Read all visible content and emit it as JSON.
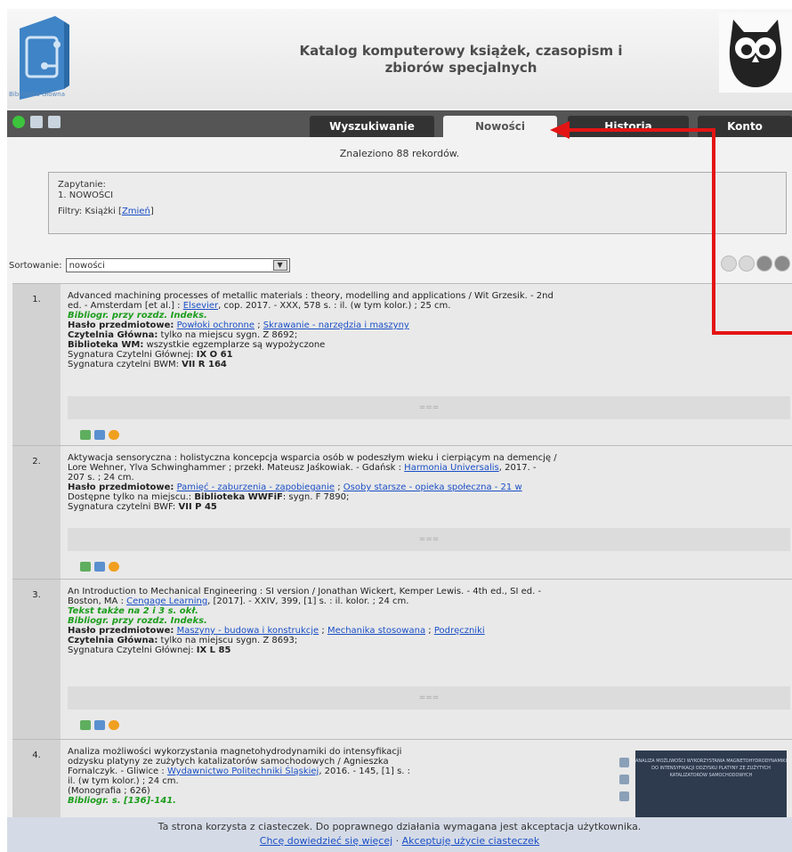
{
  "header": {
    "logo_text": "Biblioteka Główna",
    "title_line1": "Katalog komputerowy książek, czasopism i",
    "title_line2": "zbiorów specjalnych"
  },
  "tabs": [
    {
      "label": "Wyszukiwanie"
    },
    {
      "label": "Nowości"
    },
    {
      "label": "Historia"
    },
    {
      "label": "Konto"
    }
  ],
  "results": {
    "found": "Znaleziono 88 rekordów.",
    "query_label": "Zapytanie:",
    "query_value": "1. NOWOŚCI",
    "filters_label": "Filtry: Książki [",
    "filters_link": "Zmień",
    "filters_end": "]"
  },
  "sort": {
    "label": "Sortowanie:",
    "value": "nowości"
  },
  "more_label": "===",
  "records": [
    {
      "num": "1.",
      "line1": "Advanced machining processes of metallic materials : theory, modelling and applications / Wit Grzesik. - 2nd",
      "line2a": "ed. - Amsterdam [et al.] : ",
      "publisher": "Elsevier",
      "line2b": ", cop. 2017. - XXX, 578 s. : il. (w tym kolor.) ; 25 cm.",
      "note": "Bibliogr. przy rozdz. Indeks.",
      "subject_label": "Hasło przedmiotowe:",
      "subjects": [
        "Powłoki ochronne",
        "Skrawanie - narzędzia i maszyny"
      ],
      "loc1_label": "Czytelnia Główna:",
      "loc1": " tylko na miejscu sygn. Z 8692;",
      "loc2_label": "Biblioteka WM:",
      "loc2": " wszystkie egzemplarze są wypożyczone",
      "sig1_label": "Sygnatura Czytelni Głównej: ",
      "sig1": "IX O 61",
      "sig2_label": "Sygnatura czytelni BWM: ",
      "sig2": "VII R 164"
    },
    {
      "num": "2.",
      "line1": "Aktywacja sensoryczna : holistyczna koncepcja wsparcia osób w podeszłym wieku i cierpiącym na demencję /",
      "line2a": "Lore Wehner, Ylva Schwinghammer ; przekł. Mateusz Jaśkowiak. - Gdańsk : ",
      "publisher": "Harmonia Universalis",
      "line2b": ", 2017. -",
      "line3": "207 s. ; 24 cm.",
      "subject_label": "Hasło przedmiotowe:",
      "subjects": [
        "Pamięć - zaburzenia - zapobieganie",
        "Osoby starsze - opieka społeczna - 21 w"
      ],
      "loc1_label": "Dostępne tylko na miejscu.: ",
      "loc1_bold": "Biblioteka WWFiF",
      "loc1": ": sygn. F 7890;",
      "sig1_label": "Sygnatura czytelni BWF: ",
      "sig1": "VII P 45"
    },
    {
      "num": "3.",
      "line1": "An Introduction to Mechanical Engineering : SI version / Jonathan Wickert, Kemper Lewis. - 4th ed., SI ed. -",
      "line2a": "Boston, MA : ",
      "publisher": "Cengage Learning",
      "line2b": ", [2017]. - XXIV, 399, [1] s. : il. kolor. ; 24 cm.",
      "note1": "Tekst także na 2 i 3 s. okł.",
      "note2": "Bibliogr. przy rozdz. Indeks.",
      "subject_label": "Hasło przedmiotowe:",
      "subjects": [
        "Maszyny - budowa i konstrukcje",
        "Mechanika stosowana",
        "Podręczniki"
      ],
      "loc1_label": "Czytelnia Główna:",
      "loc1": " tylko na miejscu sygn. Z 8693;",
      "sig1_label": "Sygnatura Czytelni Głównej: ",
      "sig1": "IX L 85"
    },
    {
      "num": "4.",
      "line1": "Analiza możliwości wykorzystania magnetohydrodynamiki do intensyfikacji",
      "line2": "odzysku platyny ze zużytych katalizatorów samochodowych / Agnieszka",
      "line3a": "Fornalczyk. - Gliwice : ",
      "publisher": "Wydawnictwo Politechniki Śląskiej",
      "line3b": ", 2016. - 145, [1] s. :",
      "line4": "il. (w tym kolor.) ; 24 cm.",
      "line5": "(Monografia ; 626)",
      "note": "Bibliogr. s. [136]-141.",
      "cover_text": "ANALIZA MOŻLIWOŚCI WYKORZYSTANIA MAGNETOHYDRODYNAMIKI DO INTENSYFIKACJI ODZYSKU PLATYNY ZE ZUŻYTYCH KATALIZATORÓW SAMOCHODOWYCH"
    }
  ],
  "cookie": {
    "text": "Ta strona korzysta z ciasteczek. Do poprawnego działania wymagana jest akceptacja użytkownika.",
    "link1": "Chcę dowiedzieć się więcej",
    "sep": " · ",
    "link2": "Akceptuję użycie ciasteczek"
  },
  "colors": {
    "annotation_arrow": "#e41414",
    "link": "#1a4fc7",
    "note_green": "#1d9e1d"
  }
}
